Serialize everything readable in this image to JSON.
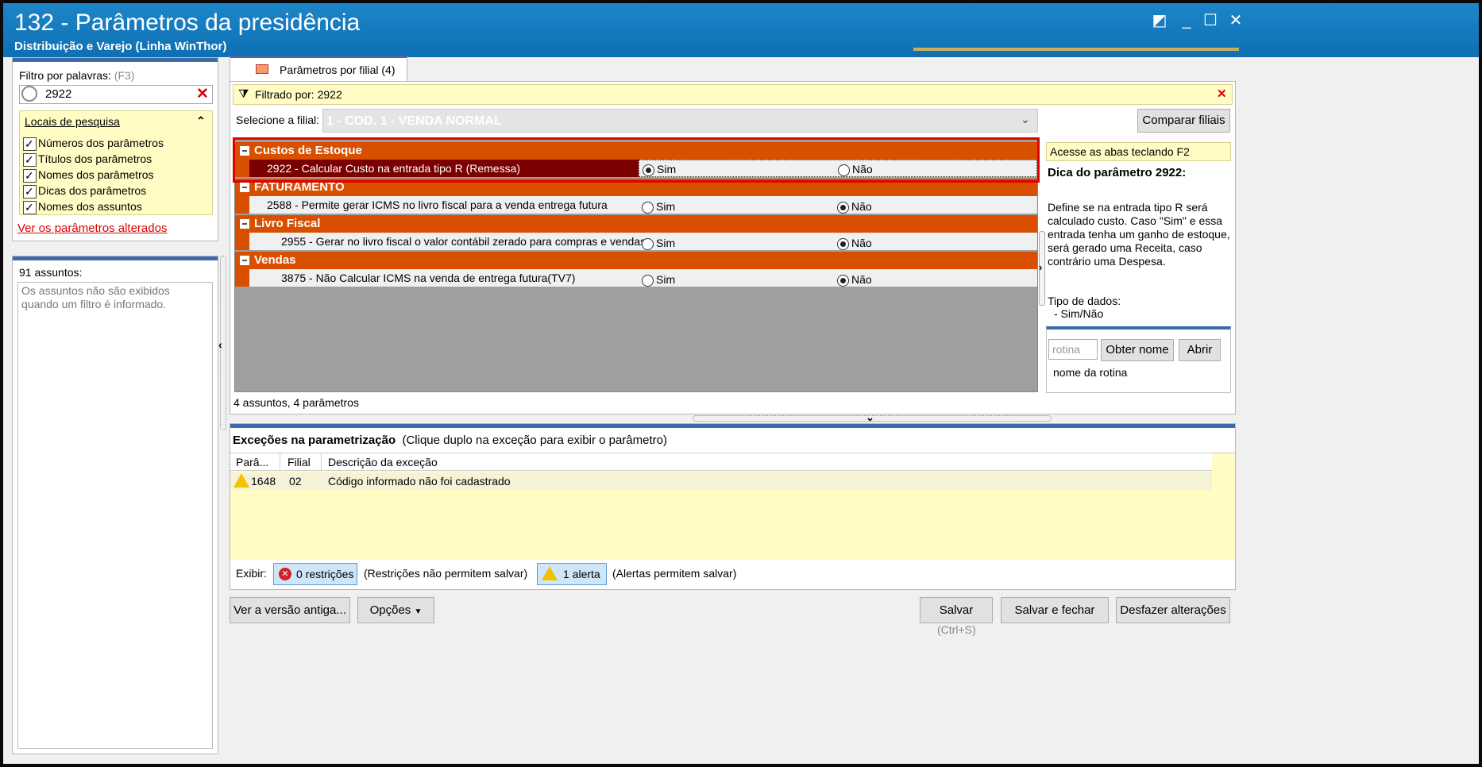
{
  "window": {
    "title": "132 - Parâmetros da presidência",
    "subtitle": "Distribuição e Varejo (Linha WinThor)"
  },
  "filter": {
    "label": "Filtro por palavras:",
    "shortcut": "(F3)",
    "value": "2922",
    "locations_title": "Locais de pesquisa",
    "options": [
      "Números dos parâmetros",
      "Títulos dos parâmetros",
      "Nomes dos parâmetros",
      "Dicas dos parâmetros",
      "Nomes dos assuntos"
    ],
    "changed_link": "Ver os parâmetros alterados"
  },
  "subjects": {
    "count_label": "91 assuntos:",
    "note": "Os assuntos não são exibidos quando um filtro é informado."
  },
  "tab": {
    "label": "Parâmetros por filial",
    "count": "(4)"
  },
  "filtered": {
    "label": "Filtrado por: 2922"
  },
  "branch": {
    "label": "Selecione a filial:",
    "value": "1 - COD. 1 - VENDA NORMAL",
    "compare_button": "Comparar filiais"
  },
  "groups": [
    {
      "name": "Custos de Estoque",
      "param": "2922 - Calcular Custo na entrada tipo R (Remessa)",
      "sim": "Sim",
      "nao": "Não",
      "selected": "sim"
    },
    {
      "name": "FATURAMENTO",
      "param": "2588 - Permite gerar ICMS no livro fiscal para a venda entrega futura",
      "sim": "Sim",
      "nao": "Não",
      "selected": "nao"
    },
    {
      "name": "Livro Fiscal",
      "param": "2955 - Gerar no livro fiscal o valor contábil zerado para compras e vendas",
      "sim": "Sim",
      "nao": "Não",
      "selected": "nao"
    },
    {
      "name": "Vendas",
      "param": "3875 - Não Calcular ICMS na venda de entrega futura(TV7)",
      "sim": "Sim",
      "nao": "Não",
      "selected": "nao"
    }
  ],
  "summary": "4 assuntos, 4 parâmetros",
  "hint": {
    "access": "Acesse as abas teclando F2",
    "title": "Dica do parâmetro 2922:",
    "body": "Define se na entrada tipo R será calculado custo. Caso \"Sim\" e essa entrada tenha um ganho de estoque, será gerado uma Receita, caso contrário uma Despesa.",
    "type_label": "Tipo de dados:",
    "type_value": "- Sim/Não",
    "routine_placeholder": "rotina",
    "get_name_button": "Obter nome",
    "open_button": "Abrir",
    "routine_name": "nome da rotina"
  },
  "exceptions": {
    "title": "Exceções na parametrização",
    "subtitle": "(Clique duplo na exceção para exibir o parâmetro)",
    "columns": [
      "Parâ...",
      "Filial",
      "Descrição da exceção"
    ],
    "rows": [
      {
        "param": "1648",
        "branch": "02",
        "description": "Código informado não foi cadastrado"
      }
    ],
    "show_label": "Exibir:",
    "restrictions_button": "0 restrições",
    "restrictions_note": "(Restrições não permitem salvar)",
    "alerts_button": "1 alerta",
    "alerts_note": "(Alertas permitem salvar)"
  },
  "footer": {
    "old_version_button": "Ver a versão antiga...",
    "options_button": "Opções",
    "save_button": "Salvar",
    "save_shortcut": "(Ctrl+S)",
    "save_close_button": "Salvar e fechar",
    "undo_button": "Desfazer alterações"
  },
  "colors": {
    "titlebar": "#1379bd",
    "group_header": "#d94f00",
    "highlight_row": "#7a0000",
    "red_outline": "#e00000",
    "yellow_panel": "#fffcc4"
  }
}
